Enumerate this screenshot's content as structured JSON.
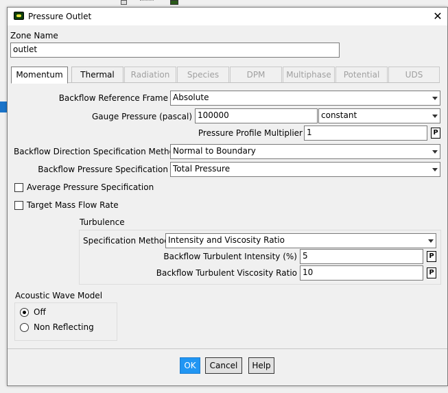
{
  "dialog": {
    "title": "Pressure Outlet",
    "close_glyph": "✕",
    "icon": "fluent-app-icon"
  },
  "zone": {
    "label": "Zone Name",
    "value": "outlet"
  },
  "tabs": [
    {
      "label": "Momentum",
      "active": true,
      "enabled": true
    },
    {
      "label": "Thermal",
      "active": false,
      "enabled": true
    },
    {
      "label": "Radiation",
      "active": false,
      "enabled": false
    },
    {
      "label": "Species",
      "active": false,
      "enabled": false
    },
    {
      "label": "DPM",
      "active": false,
      "enabled": false
    },
    {
      "label": "Multiphase",
      "active": false,
      "enabled": false
    },
    {
      "label": "Potential",
      "active": false,
      "enabled": false
    },
    {
      "label": "UDS",
      "active": false,
      "enabled": false
    }
  ],
  "momentum": {
    "backflow_ref_frame": {
      "label": "Backflow Reference Frame",
      "value": "Absolute"
    },
    "gauge_pressure": {
      "label": "Gauge Pressure (pascal)",
      "value": "100000",
      "method": "constant"
    },
    "profile_multiplier": {
      "label": "Pressure Profile Multiplier",
      "value": "1",
      "p_button": "P"
    },
    "backflow_direction": {
      "label": "Backflow Direction Specification Method",
      "value": "Normal to Boundary"
    },
    "backflow_pressure": {
      "label": "Backflow Pressure Specification",
      "value": "Total Pressure"
    },
    "avg_pressure": {
      "label": "Average Pressure Specification",
      "checked": false
    },
    "target_mass_flow": {
      "label": "Target Mass Flow Rate",
      "checked": false
    },
    "turbulence": {
      "title": "Turbulence",
      "spec_method": {
        "label": "Specification Method",
        "value": "Intensity and Viscosity Ratio"
      },
      "intensity": {
        "label": "Backflow Turbulent Intensity (%)",
        "value": "5",
        "p_button": "P"
      },
      "viscosity_ratio": {
        "label": "Backflow Turbulent Viscosity Ratio",
        "value": "10",
        "p_button": "P"
      }
    },
    "acoustic": {
      "title": "Acoustic Wave Model",
      "options": [
        {
          "label": "Off",
          "checked": true
        },
        {
          "label": "Non Reflecting",
          "checked": false
        }
      ]
    }
  },
  "buttons": {
    "ok": "OK",
    "cancel": "Cancel",
    "help": "Help"
  },
  "colors": {
    "accent": "#2196f3",
    "disabled_text": "#a0a0a0"
  }
}
